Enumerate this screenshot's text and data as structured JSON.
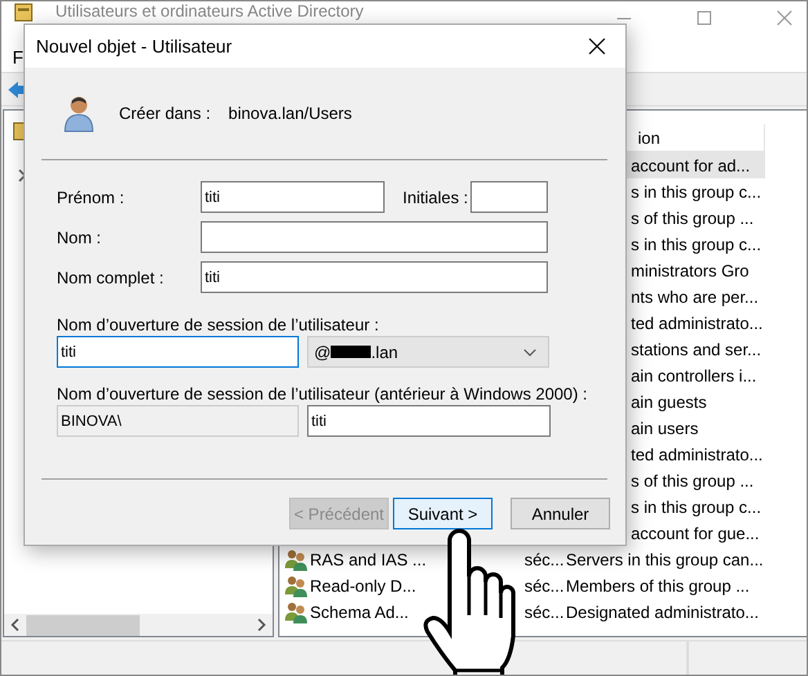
{
  "main_window": {
    "title": "Utilisateurs et ordinateurs Active Directory",
    "menu": [
      "F"
    ],
    "column_header": "ion",
    "rows": [
      {
        "description": "account for ad...",
        "selected": true
      },
      {
        "description": "s in this group c...",
        "selected": false
      },
      {
        "description": "s of this group ...",
        "selected": false
      },
      {
        "description": "s in this group c...",
        "selected": false
      },
      {
        "description": "ministrators Gro",
        "selected": false
      },
      {
        "description": "nts who are per...",
        "selected": false
      },
      {
        "description": "ted administrato...",
        "selected": false
      },
      {
        "description": "stations and ser...",
        "selected": false
      },
      {
        "description": "ain controllers i...",
        "selected": false
      },
      {
        "description": "ain guests",
        "selected": false
      },
      {
        "description": "ain users",
        "selected": false
      },
      {
        "description": "ted administrato...",
        "selected": false
      },
      {
        "description": "s of this group ...",
        "selected": false
      },
      {
        "description": "s in this group c...",
        "selected": false
      },
      {
        "description": "account for gue...",
        "selected": false
      },
      {
        "name": "RAS and IAS ...",
        "type": "séc...",
        "description": "Servers in this group can...",
        "selected": false
      },
      {
        "name": "Read-only D...",
        "type": "séc...",
        "description": "Members of this group ...",
        "selected": false
      },
      {
        "name": "Schema Ad...",
        "type": "séc...",
        "description": "Designated administrato...",
        "selected": false
      }
    ]
  },
  "dialog": {
    "title": "Nouvel objet - Utilisateur",
    "create_in_label": "Créer dans :",
    "create_in_value": "binova.lan/Users",
    "first_name": {
      "label": "Prénom :",
      "value": "titi"
    },
    "initials": {
      "label": "Initiales :"
    },
    "last_name": {
      "label": "Nom :"
    },
    "full_name": {
      "label": "Nom complet :",
      "value": "titi"
    },
    "logon": {
      "label": "Nom d’ouverture de session de l’utilisateur :",
      "value": "titi",
      "focused": true,
      "domain_prefix": "@",
      "domain_suffix": ".lan"
    },
    "logon_legacy": {
      "label": "Nom d’ouverture de session de l’utilisateur (antérieur à Windows 2000) :",
      "domain": "BINOVA\\",
      "value": "titi"
    },
    "buttons": [
      {
        "label": "< Précédent",
        "disabled": true,
        "default": false
      },
      {
        "label": "Suivant >",
        "disabled": false,
        "default": true
      },
      {
        "label": "Annuler",
        "disabled": false,
        "default": false
      }
    ]
  }
}
